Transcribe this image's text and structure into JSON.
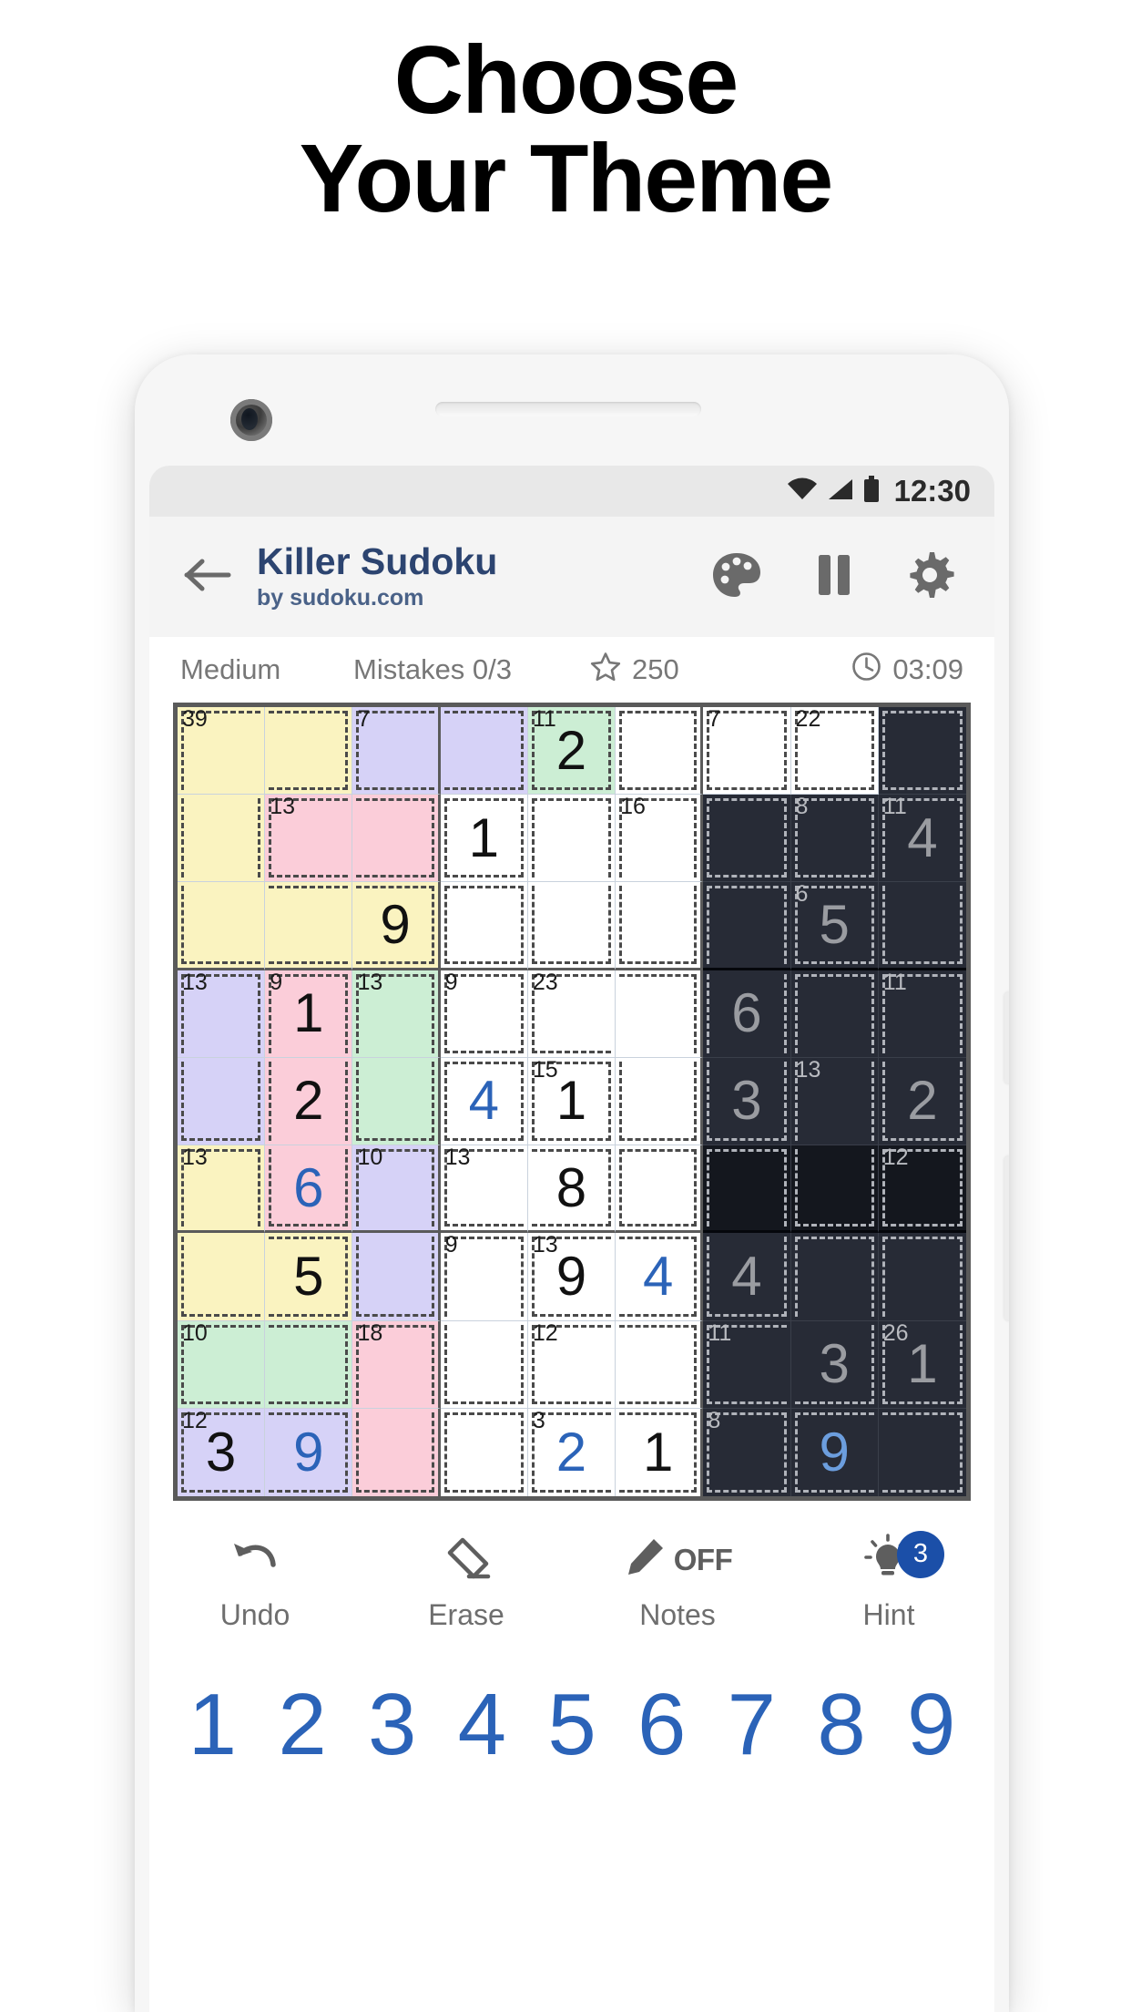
{
  "headline": {
    "line1": "Choose",
    "line2": "Your Theme"
  },
  "statusbar": {
    "time": "12:30",
    "icons": [
      "wifi-icon",
      "signal-icon",
      "battery-icon"
    ]
  },
  "appbar": {
    "back_icon": "back-arrow-icon",
    "title": "Killer Sudoku",
    "subtitle": "by sudoku.com",
    "icons": [
      "palette-icon",
      "pause-icon",
      "gear-icon"
    ]
  },
  "infobar": {
    "difficulty": "Medium",
    "mistakes": "Mistakes 0/3",
    "score": "250",
    "score_icon": "star-icon",
    "timer": "03:09",
    "timer_icon": "clock-icon"
  },
  "toolbar": {
    "items": [
      {
        "label": "Undo",
        "icon": "undo-icon"
      },
      {
        "label": "Erase",
        "icon": "eraser-icon"
      },
      {
        "label": "Notes",
        "icon": "pencil-icon",
        "state": "OFF"
      },
      {
        "label": "Hint",
        "icon": "lightbulb-icon",
        "badge": "3"
      }
    ]
  },
  "numpad": {
    "keys": [
      "1",
      "2",
      "3",
      "4",
      "5",
      "6",
      "7",
      "8",
      "9"
    ]
  },
  "colors": {
    "accent_blue": "#2b63b8",
    "title_navy": "#2c4470",
    "cage_yellow": "#faf3c0",
    "cage_purple": "#d6d2f7",
    "cage_green": "#cceed4",
    "cage_pink": "#fbcdd9",
    "cage_white": "#ffffff",
    "dark_cell": "#272b36",
    "dark_cell_alt": "#14171e",
    "dark_number": "#9a9ca1",
    "dark_user_number": "#6c9ede"
  },
  "board": {
    "size": 9,
    "themes_note": "columns 1-3 pastel, columns 4-6 white, columns 7-9 dark",
    "cells": [
      [
        {
          "v": "",
          "t": "",
          "bg": "y",
          "sum": "39"
        },
        {
          "v": "",
          "t": "",
          "bg": "y",
          "sum": ""
        },
        {
          "v": "",
          "t": "",
          "bg": "p",
          "sum": "7"
        },
        {
          "v": "",
          "t": "",
          "bg": "p",
          "sum": ""
        },
        {
          "v": "2",
          "t": "given",
          "bg": "g",
          "sum": "11"
        },
        {
          "v": "",
          "t": "",
          "bg": "w",
          "sum": ""
        },
        {
          "v": "",
          "t": "",
          "bg": "w",
          "sum": "7"
        },
        {
          "v": "",
          "t": "",
          "bg": "w",
          "sum": "22"
        },
        {
          "v": "",
          "t": "",
          "bg": "d",
          "sum": ""
        }
      ],
      [
        {
          "v": "",
          "t": "",
          "bg": "y",
          "sum": ""
        },
        {
          "v": "",
          "t": "",
          "bg": "k",
          "sum": "13"
        },
        {
          "v": "",
          "t": "",
          "bg": "k",
          "sum": ""
        },
        {
          "v": "1",
          "t": "given",
          "bg": "w",
          "sum": ""
        },
        {
          "v": "",
          "t": "",
          "bg": "w",
          "sum": ""
        },
        {
          "v": "",
          "t": "",
          "bg": "w",
          "sum": "16"
        },
        {
          "v": "",
          "t": "",
          "bg": "d",
          "sum": ""
        },
        {
          "v": "",
          "t": "",
          "bg": "d",
          "sum": "8"
        },
        {
          "v": "4",
          "t": "d-given",
          "bg": "d",
          "sum": "11"
        }
      ],
      [
        {
          "v": "",
          "t": "",
          "bg": "y",
          "sum": ""
        },
        {
          "v": "",
          "t": "",
          "bg": "y",
          "sum": ""
        },
        {
          "v": "9",
          "t": "given",
          "bg": "y",
          "sum": ""
        },
        {
          "v": "",
          "t": "",
          "bg": "w",
          "sum": ""
        },
        {
          "v": "",
          "t": "",
          "bg": "w",
          "sum": ""
        },
        {
          "v": "",
          "t": "",
          "bg": "w",
          "sum": ""
        },
        {
          "v": "",
          "t": "",
          "bg": "d",
          "sum": ""
        },
        {
          "v": "5",
          "t": "d-given",
          "bg": "d",
          "sum": "6"
        },
        {
          "v": "",
          "t": "",
          "bg": "d",
          "sum": ""
        }
      ],
      [
        {
          "v": "",
          "t": "",
          "bg": "p",
          "sum": "13"
        },
        {
          "v": "1",
          "t": "given",
          "bg": "k",
          "sum": "9"
        },
        {
          "v": "",
          "t": "",
          "bg": "g",
          "sum": "13"
        },
        {
          "v": "",
          "t": "",
          "bg": "w",
          "sum": "9"
        },
        {
          "v": "",
          "t": "",
          "bg": "w",
          "sum": "23"
        },
        {
          "v": "",
          "t": "",
          "bg": "w",
          "sum": ""
        },
        {
          "v": "6",
          "t": "d-given",
          "bg": "d",
          "sum": ""
        },
        {
          "v": "",
          "t": "",
          "bg": "d",
          "sum": ""
        },
        {
          "v": "",
          "t": "",
          "bg": "d",
          "sum": "11"
        }
      ],
      [
        {
          "v": "",
          "t": "",
          "bg": "p",
          "sum": ""
        },
        {
          "v": "2",
          "t": "given",
          "bg": "k",
          "sum": ""
        },
        {
          "v": "",
          "t": "",
          "bg": "g",
          "sum": ""
        },
        {
          "v": "4",
          "t": "user",
          "bg": "w",
          "sum": ""
        },
        {
          "v": "1",
          "t": "given",
          "bg": "w",
          "sum": "15"
        },
        {
          "v": "",
          "t": "",
          "bg": "w",
          "sum": ""
        },
        {
          "v": "3",
          "t": "d-given",
          "bg": "d",
          "sum": ""
        },
        {
          "v": "",
          "t": "",
          "bg": "d",
          "sum": "13"
        },
        {
          "v": "2",
          "t": "d-given",
          "bg": "d",
          "sum": ""
        }
      ],
      [
        {
          "v": "",
          "t": "",
          "bg": "y",
          "sum": "13"
        },
        {
          "v": "6",
          "t": "user",
          "bg": "k",
          "sum": ""
        },
        {
          "v": "",
          "t": "",
          "bg": "p",
          "sum": "10"
        },
        {
          "v": "",
          "t": "",
          "bg": "w",
          "sum": "13"
        },
        {
          "v": "8",
          "t": "given",
          "bg": "w",
          "sum": ""
        },
        {
          "v": "",
          "t": "",
          "bg": "w",
          "sum": ""
        },
        {
          "v": "",
          "t": "",
          "bg": "d2",
          "sum": ""
        },
        {
          "v": "",
          "t": "",
          "bg": "d2",
          "sum": ""
        },
        {
          "v": "",
          "t": "",
          "bg": "d2",
          "sum": "12"
        }
      ],
      [
        {
          "v": "",
          "t": "",
          "bg": "y",
          "sum": ""
        },
        {
          "v": "5",
          "t": "given",
          "bg": "y",
          "sum": ""
        },
        {
          "v": "",
          "t": "",
          "bg": "p",
          "sum": ""
        },
        {
          "v": "",
          "t": "",
          "bg": "w",
          "sum": "9"
        },
        {
          "v": "9",
          "t": "given",
          "bg": "w",
          "sum": "13"
        },
        {
          "v": "4",
          "t": "user",
          "bg": "w",
          "sum": ""
        },
        {
          "v": "4",
          "t": "d-given",
          "bg": "d",
          "sum": ""
        },
        {
          "v": "",
          "t": "",
          "bg": "d",
          "sum": ""
        },
        {
          "v": "",
          "t": "",
          "bg": "d",
          "sum": ""
        }
      ],
      [
        {
          "v": "",
          "t": "",
          "bg": "g",
          "sum": "10"
        },
        {
          "v": "",
          "t": "",
          "bg": "g",
          "sum": ""
        },
        {
          "v": "",
          "t": "",
          "bg": "k",
          "sum": "18"
        },
        {
          "v": "",
          "t": "",
          "bg": "w",
          "sum": ""
        },
        {
          "v": "",
          "t": "",
          "bg": "w",
          "sum": "12"
        },
        {
          "v": "",
          "t": "",
          "bg": "w",
          "sum": ""
        },
        {
          "v": "",
          "t": "",
          "bg": "d",
          "sum": "11"
        },
        {
          "v": "3",
          "t": "d-given",
          "bg": "d",
          "sum": ""
        },
        {
          "v": "1",
          "t": "d-given",
          "bg": "d",
          "sum": "26"
        }
      ],
      [
        {
          "v": "3",
          "t": "given",
          "bg": "p",
          "sum": "12"
        },
        {
          "v": "9",
          "t": "user",
          "bg": "p",
          "sum": ""
        },
        {
          "v": "",
          "t": "",
          "bg": "k",
          "sum": ""
        },
        {
          "v": "",
          "t": "",
          "bg": "w",
          "sum": ""
        },
        {
          "v": "2",
          "t": "user",
          "bg": "w",
          "sum": "3"
        },
        {
          "v": "1",
          "t": "given",
          "bg": "w",
          "sum": ""
        },
        {
          "v": "",
          "t": "",
          "bg": "d",
          "sum": "8"
        },
        {
          "v": "9",
          "t": "d-user",
          "bg": "d",
          "sum": ""
        },
        {
          "v": "",
          "t": "",
          "bg": "d",
          "sum": ""
        }
      ]
    ]
  }
}
